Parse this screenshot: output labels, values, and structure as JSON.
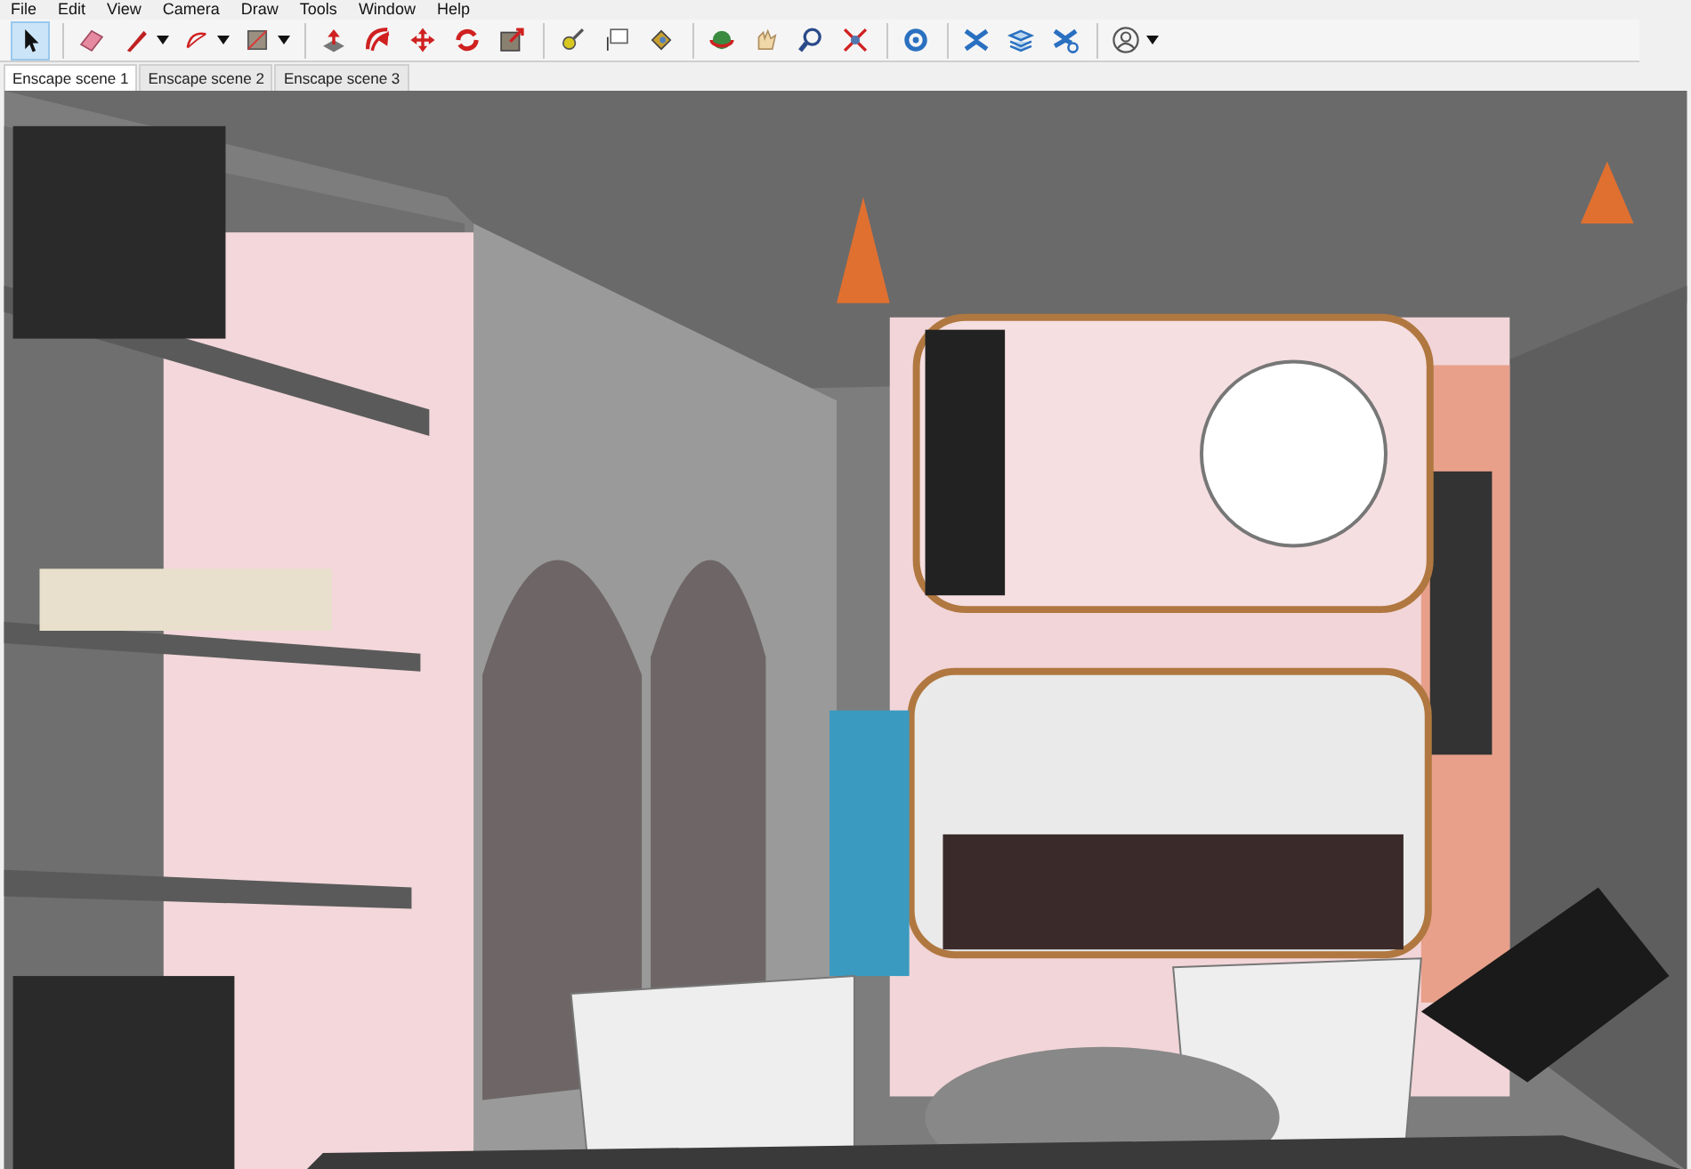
{
  "menu": [
    "File",
    "Edit",
    "View",
    "Camera",
    "Draw",
    "Tools",
    "Window",
    "Help"
  ],
  "tools": [
    {
      "selected": true,
      "dropdown": false
    },
    {
      "selected": false,
      "dropdown": false
    },
    {
      "selected": false,
      "dropdown": true
    },
    {
      "selected": false,
      "dropdown": true
    },
    {
      "selected": false,
      "dropdown": true
    },
    {
      "selected": false,
      "dropdown": false
    },
    {
      "selected": false,
      "dropdown": false
    },
    {
      "selected": false,
      "dropdown": false
    },
    {
      "selected": false,
      "dropdown": false
    },
    {
      "selected": false,
      "dropdown": false
    },
    {
      "selected": false,
      "dropdown": false
    },
    {
      "selected": false,
      "dropdown": false
    },
    {
      "selected": false,
      "dropdown": false
    },
    {
      "selected": false,
      "dropdown": false
    },
    {
      "selected": false,
      "dropdown": false
    },
    {
      "selected": false,
      "dropdown": false
    },
    {
      "selected": false,
      "dropdown": false
    },
    {
      "selected": false,
      "dropdown": false
    },
    {
      "selected": false,
      "dropdown": false
    },
    {
      "selected": false,
      "dropdown": false
    },
    {
      "selected": false,
      "dropdown": false
    },
    {
      "selected": false,
      "dropdown": true
    }
  ],
  "scene_tabs": [
    {
      "label": "Enscape scene 1",
      "selected": true
    },
    {
      "label": "Enscape scene 2",
      "selected": false
    },
    {
      "label": "Enscape scene 3",
      "selected": false
    }
  ]
}
